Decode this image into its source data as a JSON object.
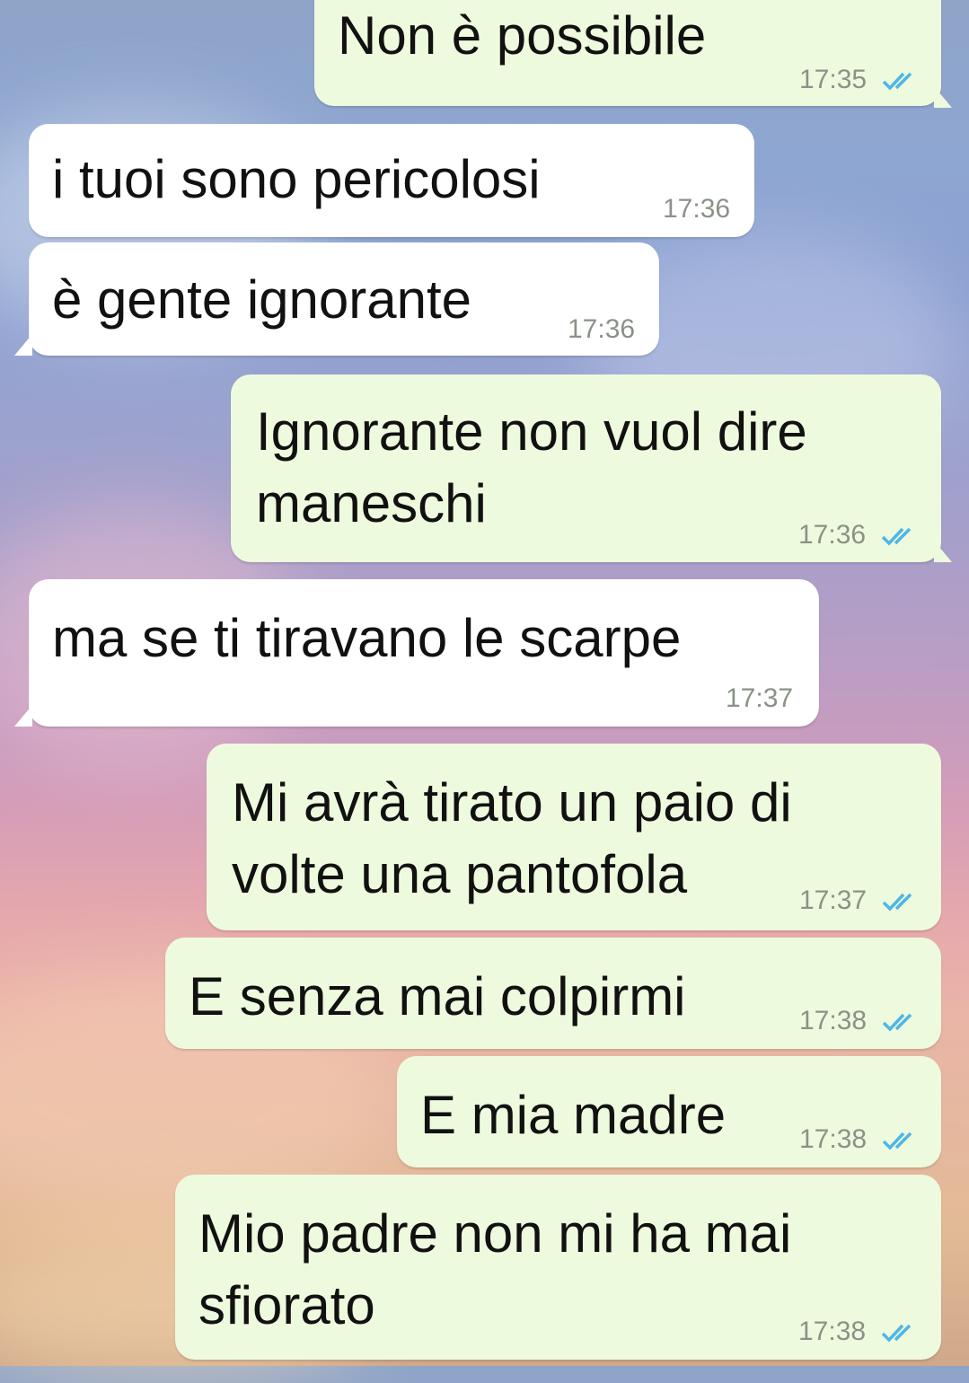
{
  "colors": {
    "incoming": "#ffffff",
    "outgoing": "#eefadd",
    "read_ticks": "#4fb6e6"
  },
  "messages": [
    {
      "dir": "out",
      "text": "Non è possibile",
      "time": "17:35",
      "status": "read-double-check-icon"
    },
    {
      "dir": "in",
      "text": "i tuoi sono pericolosi",
      "time": "17:36"
    },
    {
      "dir": "in",
      "text": "è gente ignorante",
      "time": "17:36"
    },
    {
      "dir": "out",
      "text": "Ignorante non vuol dire\nmaneschi",
      "time": "17:36",
      "status": "read-double-check-icon"
    },
    {
      "dir": "in",
      "text": "ma se ti tiravano le scarpe",
      "time": "17:37"
    },
    {
      "dir": "out",
      "text": "Mi avrà tirato un paio di\nvolte una pantofola",
      "time": "17:37",
      "status": "read-double-check-icon"
    },
    {
      "dir": "out",
      "text": "E senza mai colpirmi",
      "time": "17:38",
      "status": "read-double-check-icon"
    },
    {
      "dir": "out",
      "text": "E mia madre",
      "time": "17:38",
      "status": "read-double-check-icon"
    },
    {
      "dir": "out",
      "text": "Mio padre non mi ha mai\nsfiorato",
      "time": "17:38",
      "status": "read-double-check-icon"
    }
  ]
}
